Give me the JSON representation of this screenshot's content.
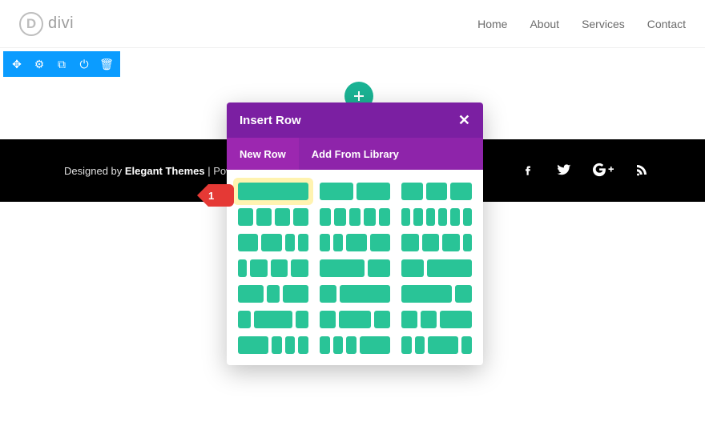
{
  "brand": {
    "name": "divi",
    "logo_letter": "D"
  },
  "nav": {
    "items": [
      "Home",
      "About",
      "Services",
      "Contact"
    ]
  },
  "toolbar": {
    "icons": [
      "move-icon",
      "gear-icon",
      "duplicate-icon",
      "power-icon",
      "trash-icon"
    ]
  },
  "footer": {
    "prefix": "Designed by ",
    "brand": "Elegant Themes",
    "suffix": " | Pow",
    "social": [
      "facebook-icon",
      "twitter-icon",
      "googleplus-icon",
      "rss-icon"
    ]
  },
  "modal": {
    "title": "Insert Row",
    "tabs": {
      "new_row": "New Row",
      "add_from_library": "Add From Library"
    },
    "layouts": [
      [
        1
      ],
      [
        1,
        1
      ],
      [
        1,
        1,
        1
      ],
      [
        1,
        1,
        1,
        1
      ],
      [
        1,
        1,
        1,
        1,
        1
      ],
      [
        1,
        1,
        1,
        1,
        1,
        1
      ],
      [
        2,
        2,
        1,
        1
      ],
      [
        1,
        1,
        2,
        2
      ],
      [
        2,
        2,
        2,
        1
      ],
      [
        1,
        2,
        2,
        2
      ],
      [
        2,
        1
      ],
      [
        1,
        2
      ],
      [
        2,
        1,
        2
      ],
      [
        1,
        3
      ],
      [
        3,
        1
      ],
      [
        1,
        3,
        1
      ],
      [
        1,
        2,
        1
      ],
      [
        1,
        1,
        2
      ],
      [
        3,
        1,
        1,
        1
      ],
      [
        1,
        1,
        1,
        3
      ],
      [
        1,
        1,
        3,
        1
      ]
    ]
  },
  "callout": {
    "label": "1"
  }
}
